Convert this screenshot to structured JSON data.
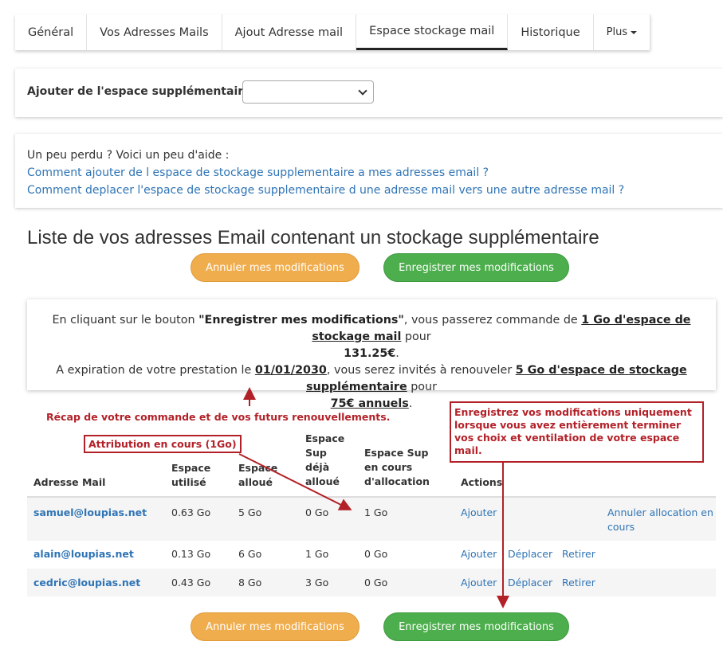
{
  "tabs": {
    "general": "Général",
    "addresses": "Vos Adresses Mails",
    "add_address": "Ajout Adresse mail",
    "storage": "Espace stockage mail",
    "history": "Historique",
    "more": "Plus"
  },
  "add_space": {
    "label": "Ajouter de l'espace supplémentaire sur :",
    "selected": ""
  },
  "help": {
    "intro": "Un peu perdu ? Voici un peu d'aide :",
    "link1": "Comment ajouter de l espace de stockage supplementaire a mes adresses email ?",
    "link2": "Comment deplacer l'espace de stockage supplementaire d une adresse mail vers une autre adresse mail ?"
  },
  "list_title": "Liste de vos adresses Email contenant un stockage supplémentaire",
  "buttons": {
    "cancel": "Annuler mes modifications",
    "save": "Enregistrer mes modifications"
  },
  "info": {
    "l1_pre": "En cliquant sur le bouton ",
    "l1_btn": "\"Enregistrer mes modifications\"",
    "l1_mid": ", vous passerez commande de ",
    "l1_qty": "1 Go d'espace de stockage mail",
    "l1_post": " pour",
    "l2_price": "131.25€",
    "l2_dot": ".",
    "l3_pre": "A expiration de votre prestation le ",
    "l3_date": "01/01/2030",
    "l3_mid": ", vous serez invités à renouveler ",
    "l3_qty": "5 Go d'espace de stockage supplémentaire",
    "l3_post": " pour",
    "l4_price": "75€ annuels",
    "l4_dot": "."
  },
  "annotations": {
    "recap": "Récap de votre commande et de vos futurs renouvellements.",
    "attribution": "Attribution en cours (1Go)",
    "save_note": "Enregistrez vos modifications uniquement lorsque vous avez entièrement terminer vos choix et ventilation de votre espace mail.",
    "color": "#b32128"
  },
  "table": {
    "headers": {
      "email": "Adresse Mail",
      "used_1": "Espace",
      "used_2": "utilisé",
      "alloc_1": "Espace",
      "alloc_2": "alloué",
      "sup_1": "Espace",
      "sup_2": "Sup",
      "sup_3": "déjà",
      "sup_4": "alloué",
      "pending_1": "Espace Sup",
      "pending_2": "en cours",
      "pending_3": "d'allocation",
      "actions": "Actions"
    },
    "rows": [
      {
        "email": "samuel@loupias.net",
        "used": "0.63 Go",
        "allocated": "5 Go",
        "sup": "0 Go",
        "pending": "1 Go",
        "add": "Ajouter",
        "cancel_1": "Annuler allocation en",
        "cancel_2": "cours"
      },
      {
        "email": "alain@loupias.net",
        "used": "0.13 Go",
        "allocated": "6 Go",
        "sup": "1 Go",
        "pending": "0 Go",
        "add": "Ajouter",
        "move": "Déplacer",
        "remove": "Retirer"
      },
      {
        "email": "cedric@loupias.net",
        "used": "0.43 Go",
        "allocated": "8 Go",
        "sup": "3 Go",
        "pending": "0 Go",
        "add": "Ajouter",
        "move": "Déplacer",
        "remove": "Retirer"
      }
    ]
  },
  "colors": {
    "link": "#2f74b5",
    "cancel_button": "#f0ad4e",
    "save_button": "#4cae4c"
  }
}
